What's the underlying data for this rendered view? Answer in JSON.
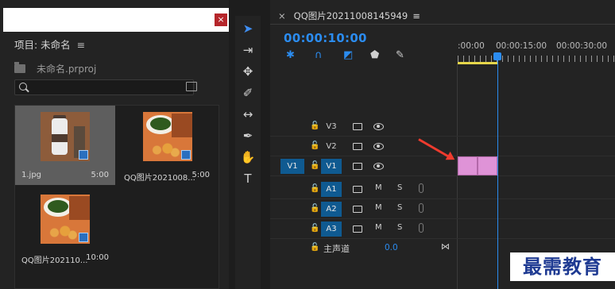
{
  "project": {
    "close_label": "×",
    "title": "项目: 未命名",
    "menu_label": "≡",
    "project_file": "未命名.prproj",
    "search_placeholder": "",
    "items": [
      {
        "name": "1.jpg",
        "duration": "5:00",
        "selected": true
      },
      {
        "name": "QQ图片2021008...",
        "duration": "5:00",
        "selected": false
      },
      {
        "name": "QQ图片202110...",
        "duration": "10:00",
        "selected": false
      }
    ]
  },
  "tools": [
    {
      "name": "selection-tool",
      "glyph": "➤",
      "active": true
    },
    {
      "name": "track-select-tool",
      "glyph": "⇥",
      "active": false
    },
    {
      "name": "ripple-edit-tool",
      "glyph": "✥",
      "active": false
    },
    {
      "name": "razor-tool",
      "glyph": "✐",
      "active": false
    },
    {
      "name": "slip-tool",
      "glyph": "↔",
      "active": false
    },
    {
      "name": "pen-tool",
      "glyph": "✒",
      "active": false
    },
    {
      "name": "hand-tool",
      "glyph": "✋",
      "active": false
    },
    {
      "name": "type-tool",
      "glyph": "T",
      "active": false
    }
  ],
  "timeline": {
    "close_label": "×",
    "sequence_name": "QQ图片20211008145949",
    "menu_label": "≡",
    "timecode": "00:00:10:00",
    "ruler_labels": [
      ":00:00",
      "00:00:15:00",
      "00:00:30:00"
    ],
    "video_tracks": [
      {
        "name": "V3",
        "source": ""
      },
      {
        "name": "V2",
        "source": ""
      },
      {
        "name": "V1",
        "source": "V1"
      }
    ],
    "audio_tracks": [
      {
        "name": "A1",
        "m": "M",
        "s": "S"
      },
      {
        "name": "A2",
        "m": "M",
        "s": "S"
      },
      {
        "name": "A3",
        "m": "M",
        "s": "S"
      }
    ],
    "master_label": "主声道",
    "master_value": "0.0",
    "accent_color": "#2b8cf0",
    "clip_color": "#df93d7",
    "track_highlight_color": "#0f5a91"
  },
  "watermark": "最需教育"
}
